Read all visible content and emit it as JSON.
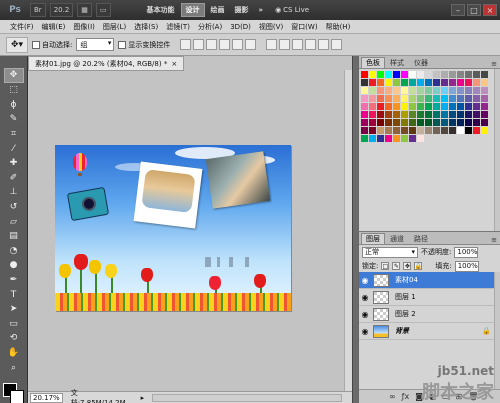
{
  "appbar": {
    "logo": "Ps",
    "zoom": "20.2",
    "workspaces": [
      "基本功能",
      "设计",
      "绘画",
      "摄影"
    ],
    "active_workspace_index": 1,
    "more": "»",
    "cslive": "CS Live"
  },
  "menu": [
    "文件(F)",
    "编辑(E)",
    "图像(I)",
    "图层(L)",
    "选择(S)",
    "滤镜(T)",
    "分析(A)",
    "3D(D)",
    "视图(V)",
    "窗口(W)",
    "帮助(H)"
  ],
  "options": {
    "auto_select_label": "自动选择:",
    "auto_select_value": "组",
    "show_transform_label": "显示变换控件"
  },
  "document": {
    "tab_title": "素材01.jpg @ 20.2% (素材04, RGB/8) *",
    "zoom": "20.17%",
    "doc_size": "文档:7.85M/14.2M"
  },
  "swatches": {
    "tabs": [
      "色板",
      "样式",
      "仪器"
    ],
    "colors": [
      "#ff0000",
      "#ffff00",
      "#00ff00",
      "#00ffff",
      "#0000ff",
      "#ff00ff",
      "#ffffff",
      "#ebebeb",
      "#d6d6d6",
      "#c2c2c2",
      "#adadad",
      "#999999",
      "#858585",
      "#707070",
      "#5c5c5c",
      "#474747",
      "#333333",
      "#ed1c24",
      "#f26522",
      "#fff200",
      "#8dc63f",
      "#00a651",
      "#00a99d",
      "#00aeef",
      "#0072bc",
      "#2e3192",
      "#662d91",
      "#92278f",
      "#ec008c",
      "#ed145b",
      "#f69679",
      "#fdc689",
      "#fff799",
      "#c4df9b",
      "#f7977a",
      "#f9ad81",
      "#fdc68a",
      "#fff79a",
      "#c4df9b",
      "#a3d39c",
      "#82ca9d",
      "#7bcdc8",
      "#6ecff6",
      "#7ea7d8",
      "#8493ca",
      "#8882be",
      "#a187be",
      "#bc8dbf",
      "#f49ac2",
      "#f6989d",
      "#f26c4f",
      "#f68e55",
      "#fbaf5c",
      "#fff467",
      "#acd372",
      "#7cc576",
      "#3bb878",
      "#1abbb4",
      "#00bff3",
      "#438ccb",
      "#5574b9",
      "#605ca8",
      "#855fa8",
      "#a763a8",
      "#f06ea9",
      "#f26d7d",
      "#ed1c24",
      "#f26522",
      "#f7941d",
      "#fff200",
      "#8dc63f",
      "#39b54a",
      "#00a651",
      "#00a99d",
      "#00aeef",
      "#0072bc",
      "#0054a6",
      "#2e3192",
      "#662d91",
      "#92278f",
      "#ec008c",
      "#ed145b",
      "#9e0b0f",
      "#a0410d",
      "#a3620a",
      "#aba000",
      "#598527",
      "#1a7b30",
      "#007236",
      "#00746b",
      "#0076a3",
      "#004b80",
      "#003471",
      "#1b1464",
      "#440e62",
      "#630460",
      "#9e005d",
      "#9e0039",
      "#790000",
      "#7b2e00",
      "#7d4900",
      "#827b00",
      "#406618",
      "#005e20",
      "#005826",
      "#005952",
      "#005b7f",
      "#003663",
      "#002157",
      "#0d004c",
      "#32004b",
      "#4b0049",
      "#7b0046",
      "#7a0026",
      "#c69c6d",
      "#a67c52",
      "#8c6239",
      "#754c24",
      "#603913",
      "#c7b299",
      "#998675",
      "#736357",
      "#534741",
      "#362f2d",
      "#ffffff",
      "#000000",
      "#ed1c24",
      "#fff200",
      "#00a651",
      "#00aeef",
      "#2e3192",
      "#ec008c",
      "#f7941d",
      "#8dc63f",
      "#662d91",
      "#ffe3e3"
    ]
  },
  "layers": {
    "tabs": [
      "图层",
      "通道",
      "路径"
    ],
    "blend_mode": "正常",
    "opacity_label": "不透明度:",
    "opacity": "100%",
    "lock_label": "锁定:",
    "fill_label": "填充:",
    "fill": "100%",
    "items": [
      {
        "name": "素材04",
        "selected": true
      },
      {
        "name": "图层 1",
        "selected": false
      },
      {
        "name": "图层 2",
        "selected": false
      },
      {
        "name": "背景",
        "selected": false
      }
    ]
  },
  "watermark": {
    "url": "jb51.net",
    "text": "脚本之家"
  }
}
